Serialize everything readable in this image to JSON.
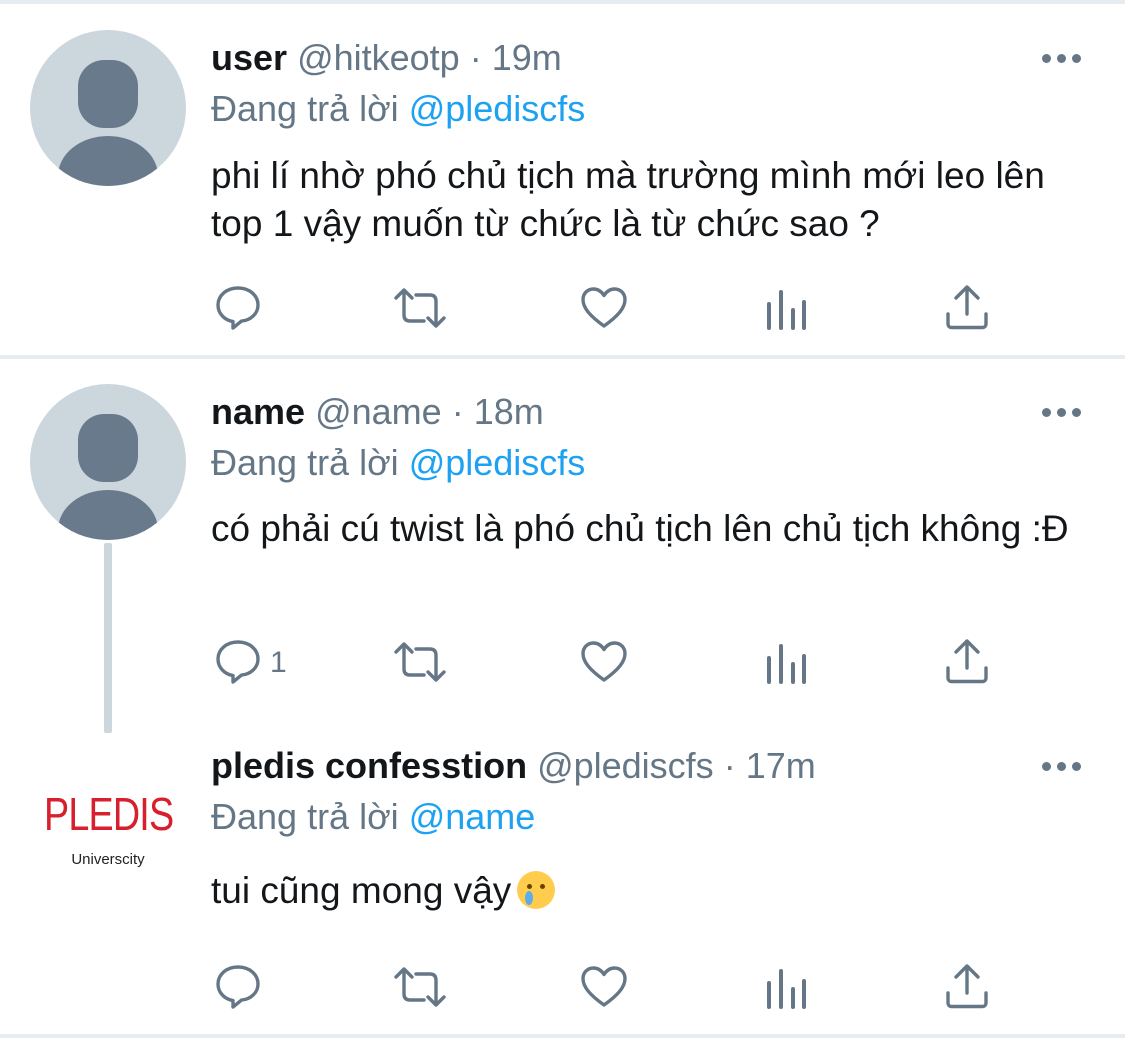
{
  "tweets": [
    {
      "name": "user",
      "handle": "@hitkeotp",
      "separator": "·",
      "time": "19m",
      "reply_prefix": "Đang trả lời",
      "reply_to": "@plediscfs",
      "text": "phi lí nhờ phó chủ tịch mà trường mình mới leo lên top 1 vậy muốn từ chức là từ chức sao ?",
      "reply_count": ""
    },
    {
      "name": "name",
      "handle": "@name",
      "separator": "·",
      "time": "18m",
      "reply_prefix": "Đang trả lời",
      "reply_to": "@plediscfs",
      "text": "có phải cú twist là phó chủ tịch lên chủ tịch không :Đ",
      "reply_count": "1"
    },
    {
      "name": "pledis confesstion",
      "handle": "@plediscfs",
      "separator": "·",
      "time": "17m",
      "reply_prefix": "Đang trả lời",
      "reply_to": "@name",
      "text": "tui cũng mong vậy",
      "emoji": "crying-face-emoji",
      "reply_count": "",
      "logo_mark": "PLEDIS",
      "logo_sub": "Universcity"
    }
  ],
  "icons": {
    "reply": "reply-icon",
    "retweet": "retweet-icon",
    "like": "heart-icon",
    "analytics": "analytics-icon",
    "share": "share-icon",
    "more": "more-dots-icon"
  },
  "colors": {
    "text": "#14171a",
    "secondary": "#657786",
    "link": "#1da1f2",
    "avatar_bg": "#ccd6dd",
    "avatar_fg": "#687a8c",
    "divider": "#e6ecf0",
    "logo_red": "#d71f2d"
  }
}
